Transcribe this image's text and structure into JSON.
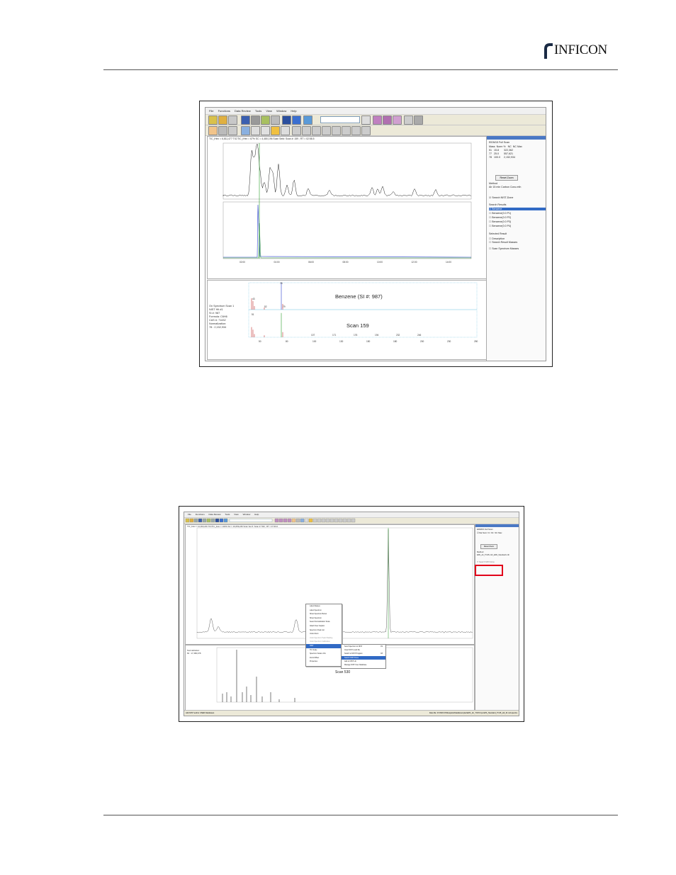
{
  "header": {
    "logo_text": "INFICON"
  },
  "figure1": {
    "menu": [
      "File",
      "Functions",
      "Data Review",
      "Tools",
      "View",
      "Window",
      "Help"
    ],
    "tic_header": "TIC_iHex = 6,811,477  TIC/TIC_iHex = 67%  SC = 4,480,196  Scan Set#:  Scan #:  159 ; RT = 02:58.5",
    "panel": {
      "title": "",
      "scan_label": "EIDM15 Full Scan",
      "table_headers": [
        "Mass",
        "Norm %",
        "NC",
        "NC Max"
      ],
      "rows": [
        {
          "mass": "51",
          "norm": "15.8",
          "max": "322,362"
        },
        {
          "mass": "77",
          "norm": "25.0",
          "max": "557,621"
        },
        {
          "mass": "78",
          "norm": "100.0",
          "max": "2,152,934"
        }
      ],
      "reset_label": "Reset Zoom",
      "method_label": "Method",
      "method_value": "Air 15 min Carbon Conc.mth",
      "search_nist": "Search NIST-Done",
      "search_results": "Search Results",
      "results": [
        "Benzene",
        "Benzene(0.0 P1)",
        "Benzene(0.0 P2)",
        "Benzene(0.0 P3)",
        "Benzene(0.0 P4)"
      ],
      "selected_result": "Selected Result",
      "description": "Description",
      "search_result_masses": "Search Result Masses",
      "scan_spectrum_masses": "Scan Spectrum Masses"
    },
    "spectrum_info": [
      "On Spectrum Scan 1",
      "NIST Hit #1",
      "SI #: 987",
      "Formula: C6H6",
      "CAS #: 71432",
      "",
      "Normalization:",
      "  78 : 2,152,934"
    ],
    "library_title": "Benzene (SI #: 987)",
    "scan_title": "Scan 159",
    "tic_axis": [
      "02:00",
      "04:00",
      "06:00",
      "08:00",
      "10:00",
      "12:00",
      "14:00"
    ],
    "ms_axis": [
      "50",
      "80",
      "100",
      "130",
      "150",
      "180",
      "200",
      "230",
      "250"
    ],
    "peak_labels": [
      "51",
      "78",
      "43",
      "52",
      "79",
      "107",
      "171",
      "176",
      "194",
      "232",
      "246"
    ]
  },
  "figure2": {
    "menu": [
      "File",
      "Functions",
      "Data Review",
      "Tools",
      "View",
      "Window",
      "Help"
    ],
    "tic_header": "TIC_iHex = 14,060,246  TIC/TIC_iHex = 100%  SC = 19,059,246  Scan Set #:  Scan #:  530 ; RT = 07:36.0",
    "panel": {
      "scan_label": "EIDM15 Full Scan",
      "table_headers": [
        "Ma",
        "Norm %",
        "NC",
        "NC Max"
      ],
      "reset_label": "Reset Zoom",
      "method_label": "Method",
      "method_value": "EPA_Air_TO15.mth_EPA_Standard.mth",
      "search_nist": "Search NIST-Done"
    },
    "context_menu": [
      "Label Masses",
      "Label Spectrum",
      "Show Spectrum Below",
      "Show Spectrum",
      "Select Normalization Scale",
      "Attach New Caption",
      "Spectrum Peak List",
      "Undo Zoom",
      "Undo Spectrum Peak Shading",
      "Undo Spectrum Calibration",
      "NIST",
      "TIC Scale",
      "Spectrum Scale LOG",
      "Zoom/Offset",
      "Properties"
    ],
    "submenu": [
      "Send Spectrum to NIST",
      "Clear NIST result file",
      "Switch to NIST Program",
      "Search NIST Done",
      "Add to NIST Lib",
      "Manage NIST User Database"
    ],
    "submenu_keys": [
      "F9",
      "",
      "F8",
      "",
      "",
      ""
    ],
    "normalization": [
      "Normalization:",
      " 84 : 17,386,978"
    ],
    "scan_title": "Scan 530",
    "status_left": "Add NIST and/or USER Databases",
    "status_right": "Data file: D:\\INFICON\\Hapsite\\Data\\Examples\\EPA_Air_TO15.hps  EPA_Standard_TO15_std_01 std.spectra"
  },
  "colors": {
    "highlight_red": "#e1001a",
    "accent_blue": "#316ac5",
    "toolbar_bg": "#ece9d8"
  }
}
